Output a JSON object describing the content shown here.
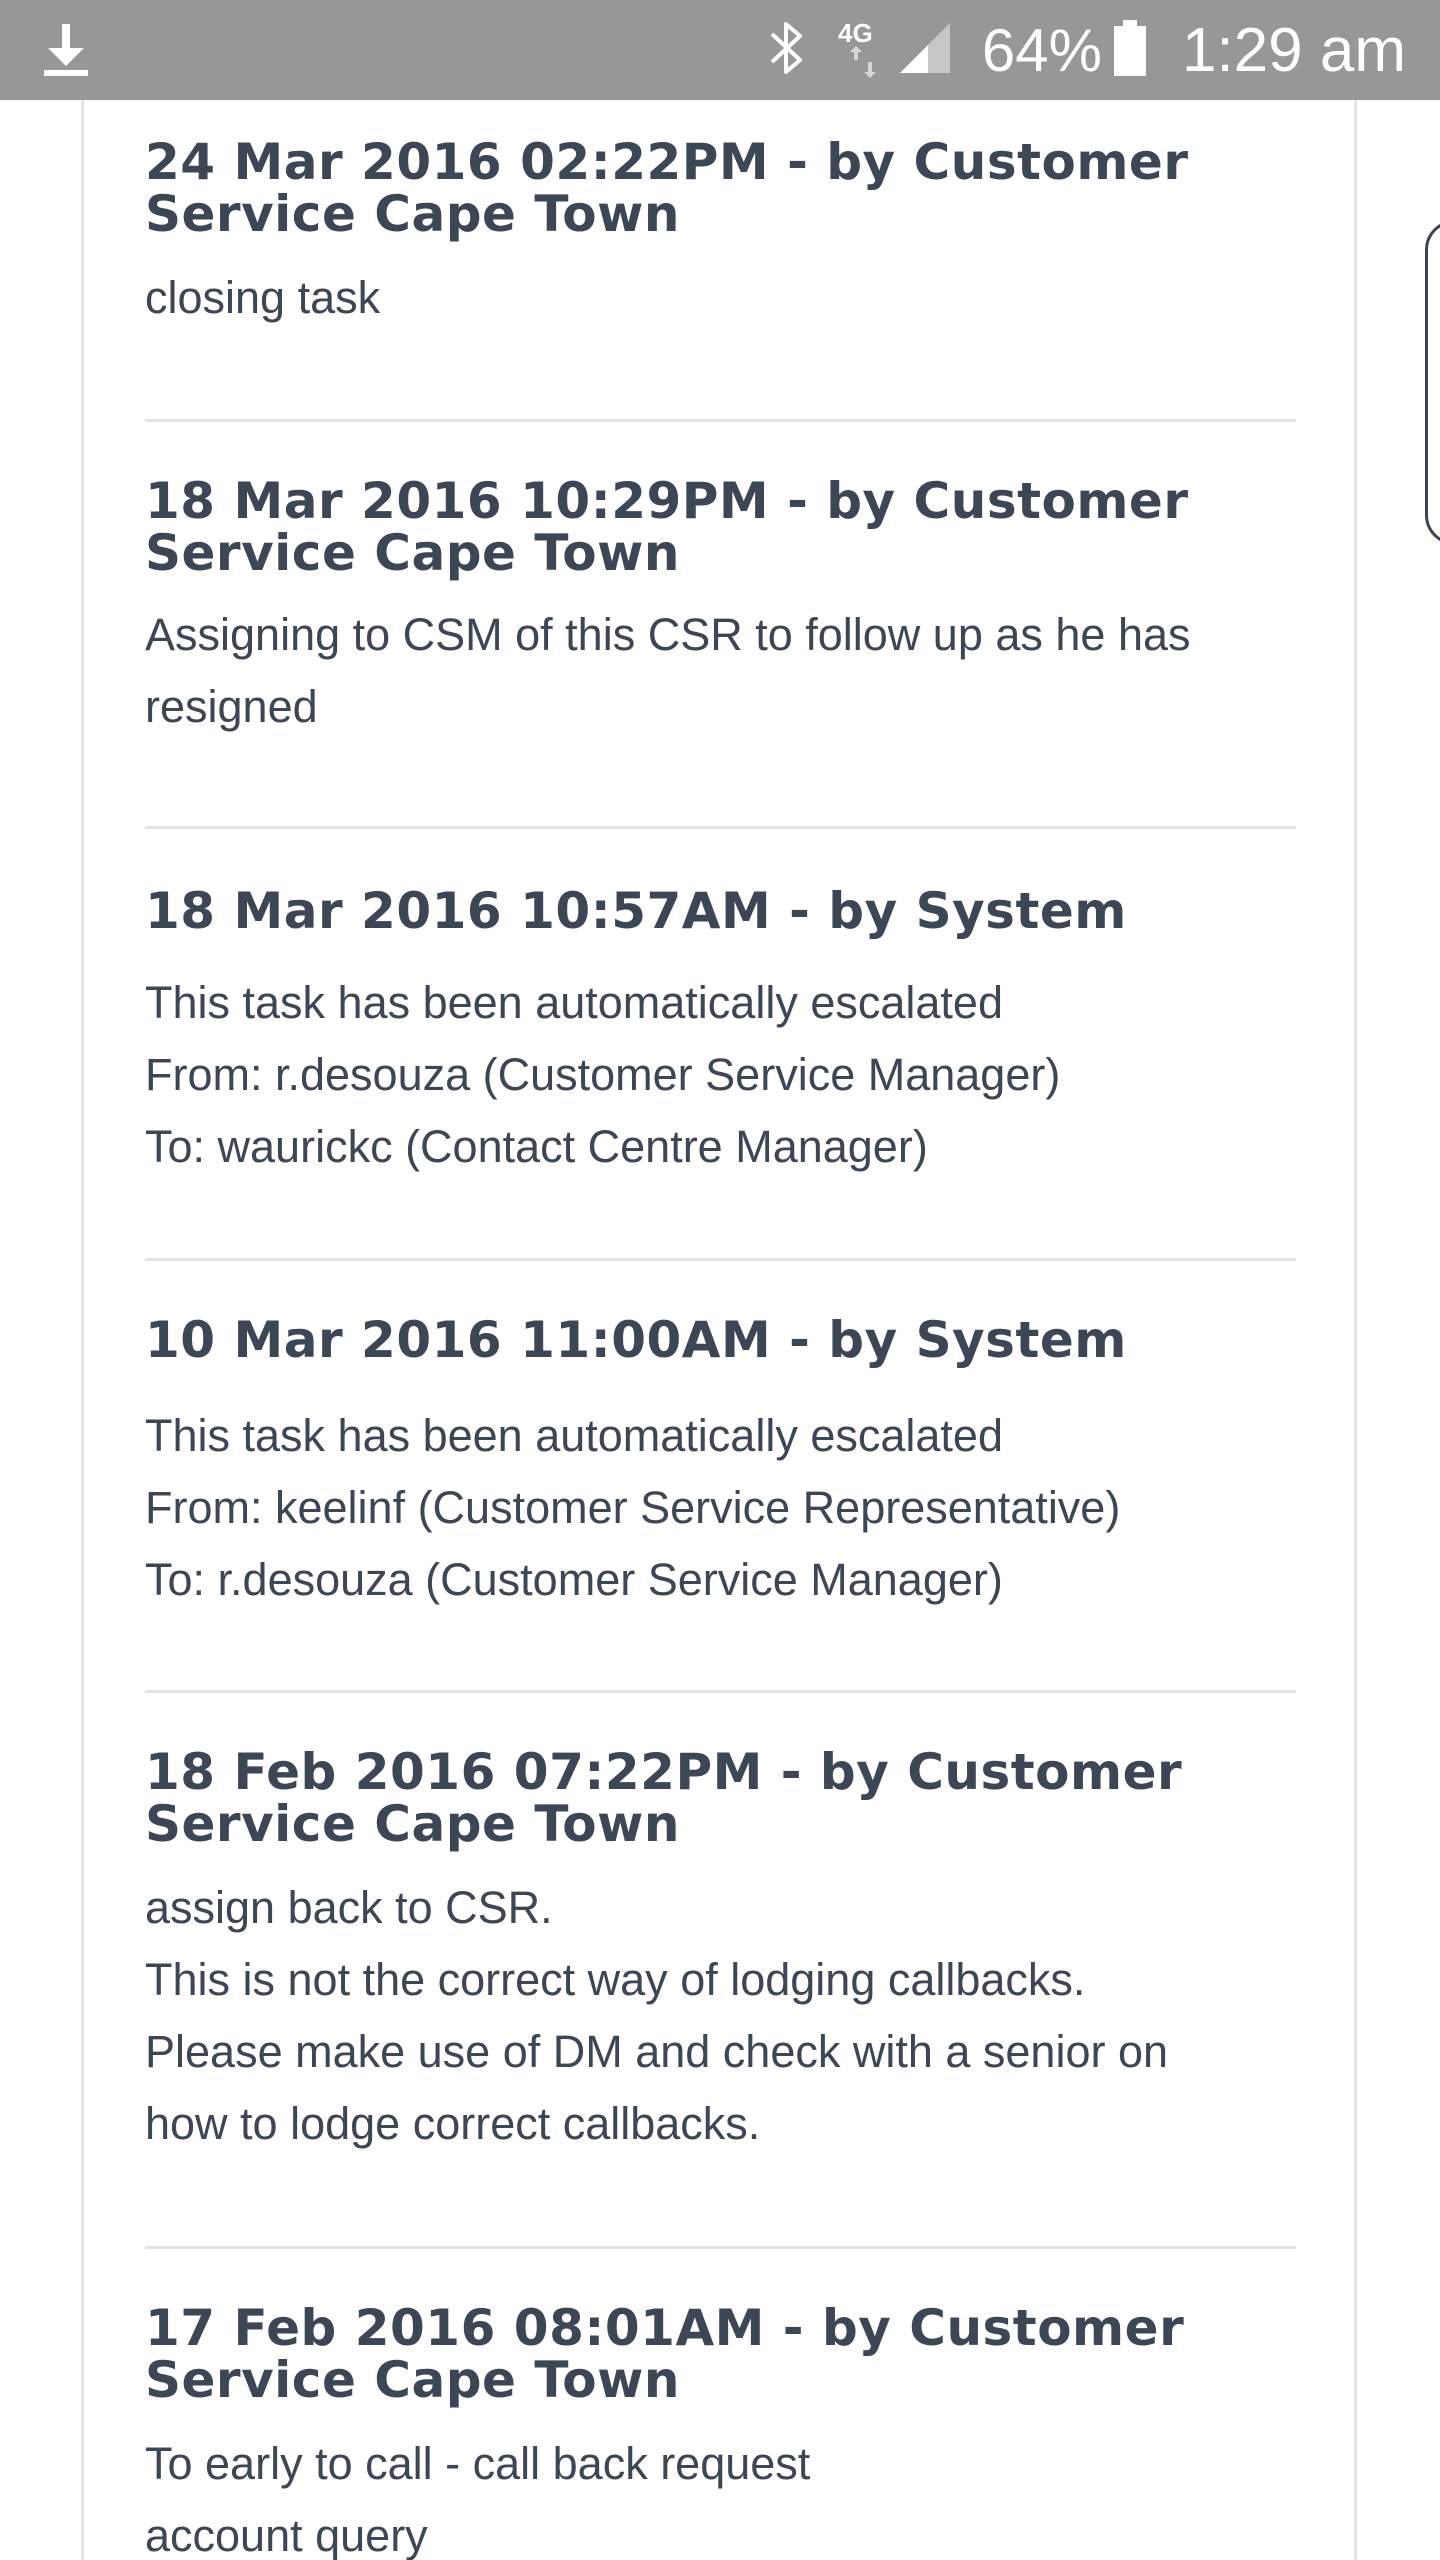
{
  "status_bar": {
    "battery_percent": "64%",
    "time": "1:29 am",
    "network_label": "4G",
    "icons": [
      "download-icon",
      "bluetooth-icon",
      "network-4g-icon",
      "signal-icon",
      "battery-icon"
    ]
  },
  "entries": [
    {
      "header_line1": "24 Mar 2016 02:22PM - by Customer",
      "header_line2": "Service Cape Town",
      "body": [
        "closing task"
      ]
    },
    {
      "header_line1": "18 Mar 2016 10:29PM - by Customer",
      "header_line2": "Service Cape Town",
      "body": [
        "Assigning to CSM of this CSR to follow up as he has",
        "resigned"
      ]
    },
    {
      "header_line1": "18 Mar 2016 10:57AM - by System",
      "header_line2": "",
      "body": [
        "This task has been automatically escalated",
        "From: r.desouza (Customer Service Manager)",
        "To: waurickc (Contact Centre Manager)"
      ]
    },
    {
      "header_line1": "10 Mar 2016 11:00AM - by System",
      "header_line2": "",
      "body": [
        "This task has been automatically escalated",
        "From: keelinf (Customer Service Representative)",
        "To: r.desouza (Customer Service Manager)"
      ]
    },
    {
      "header_line1": "18 Feb 2016 07:22PM - by Customer",
      "header_line2": "Service Cape Town",
      "body": [
        "assign back to CSR.",
        "This is not the correct way of lodging callbacks.",
        "Please make use of DM and check with a senior on",
        "how to lodge correct callbacks."
      ]
    },
    {
      "header_line1": "17 Feb 2016 08:01AM - by Customer",
      "header_line2": "Service Cape Town",
      "body": [
        "To early to call - call back request",
        "account query"
      ]
    }
  ]
}
